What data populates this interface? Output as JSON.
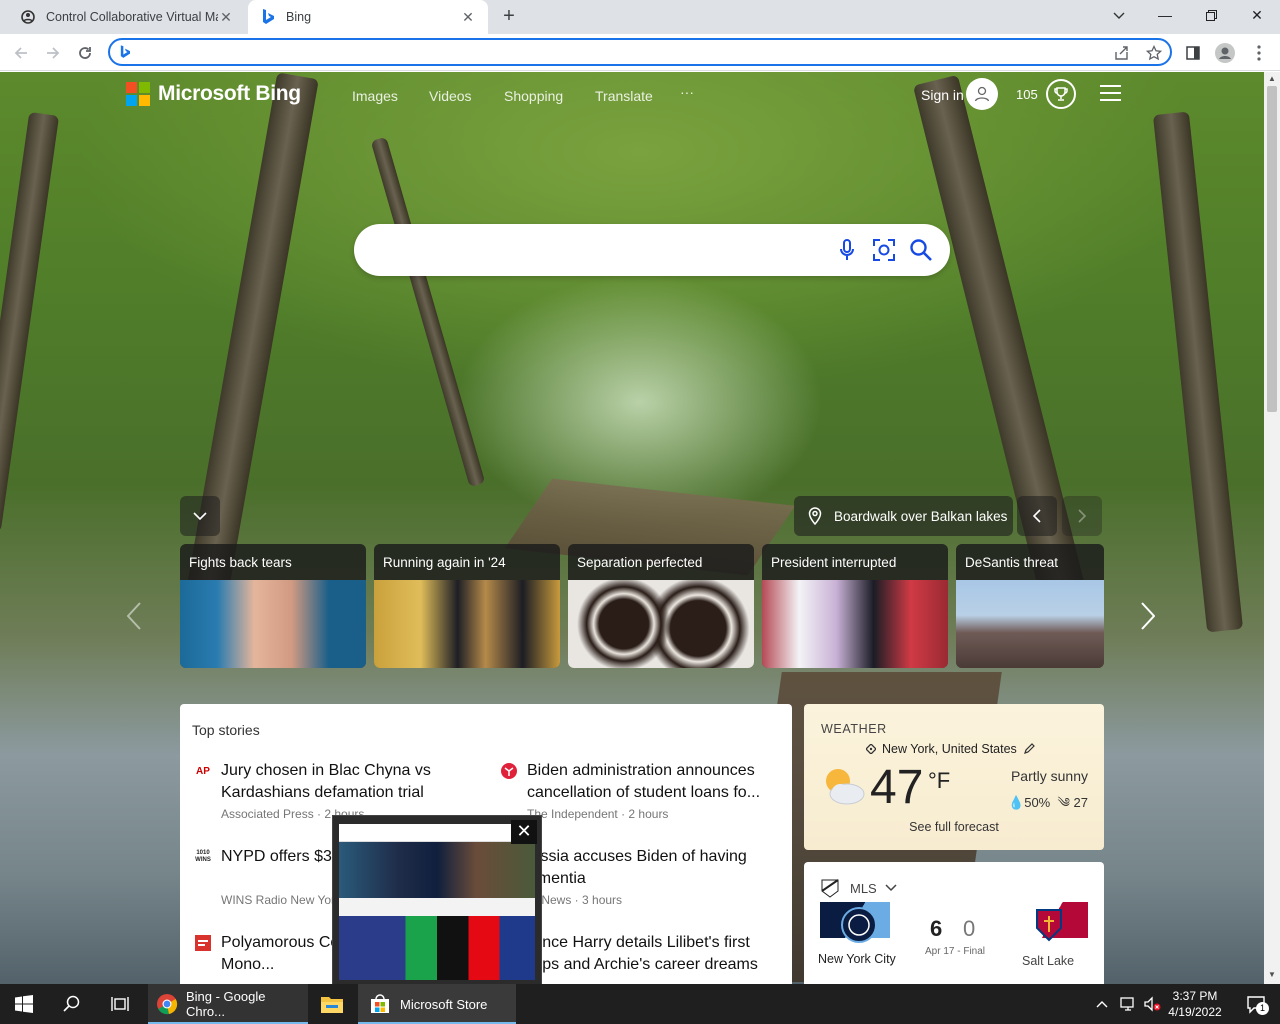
{
  "tabs": [
    {
      "title": "Control Collaborative Virtual Mac",
      "active": false
    },
    {
      "title": "Bing",
      "active": true
    }
  ],
  "toolbar": {
    "address_value": "",
    "address_placeholder": ""
  },
  "bing": {
    "brand": "Microsoft Bing",
    "nav": [
      "Images",
      "Videos",
      "Shopping",
      "Translate",
      "···"
    ],
    "sign_in": "Sign in",
    "points": "105",
    "search_placeholder": "",
    "image_title": "Boardwalk over Balkan lakes"
  },
  "news_cards": [
    {
      "title": "Fights back tears"
    },
    {
      "title": "Running again in '24"
    },
    {
      "title": "Separation perfected"
    },
    {
      "title": "President interrupted"
    },
    {
      "title": "DeSantis threat"
    }
  ],
  "top_stories": {
    "heading": "Top stories",
    "items": [
      {
        "source_icon": "AP",
        "headline": "Jury chosen in Blac Chyna vs Kardashians defamation trial",
        "meta": "Associated Press · 2 hours"
      },
      {
        "source_icon": "",
        "headline": "Biden administration announces cancellation of student loans fo...",
        "meta": "The Independent · 2 hours"
      },
      {
        "source_icon": "1010 WINS",
        "headline": "NYPD offers $3... slaying of Quee...",
        "meta": "WINS Radio New Yor..."
      },
      {
        "source_icon": "",
        "headline": "Russia accuses Biden of having dementia",
        "meta": "...X News · 3 hours"
      },
      {
        "source_icon": "",
        "headline": "Polyamorous Co... You Wish Mono...",
        "meta": ""
      },
      {
        "source_icon": "",
        "headline": "...rince Harry details Lilibet's first ...eps and Archie's career dreams",
        "meta": ""
      }
    ]
  },
  "weather": {
    "label": "WEATHER",
    "location": "New York, United States",
    "temp": "47",
    "unit": "°F",
    "condition": "Partly sunny",
    "precip": "50%",
    "wind": "27",
    "link": "See full forecast"
  },
  "mls": {
    "league": "MLS",
    "home_team": "New York City",
    "away_team": "Salt Lake",
    "home_score": "6",
    "away_score": "0",
    "date": "Apr 17 - Final"
  },
  "taskbar": {
    "apps": [
      {
        "label": "Bing - Google Chro...",
        "active": false
      },
      {
        "label": "Microsoft Store",
        "active": true
      }
    ],
    "time": "3:37 PM",
    "date": "4/19/2022",
    "notification_count": "1"
  },
  "colors": {
    "bing_blue": "#174ae4",
    "chrome_blue": "#1a73e8",
    "taskbar": "#1f1f1f"
  }
}
